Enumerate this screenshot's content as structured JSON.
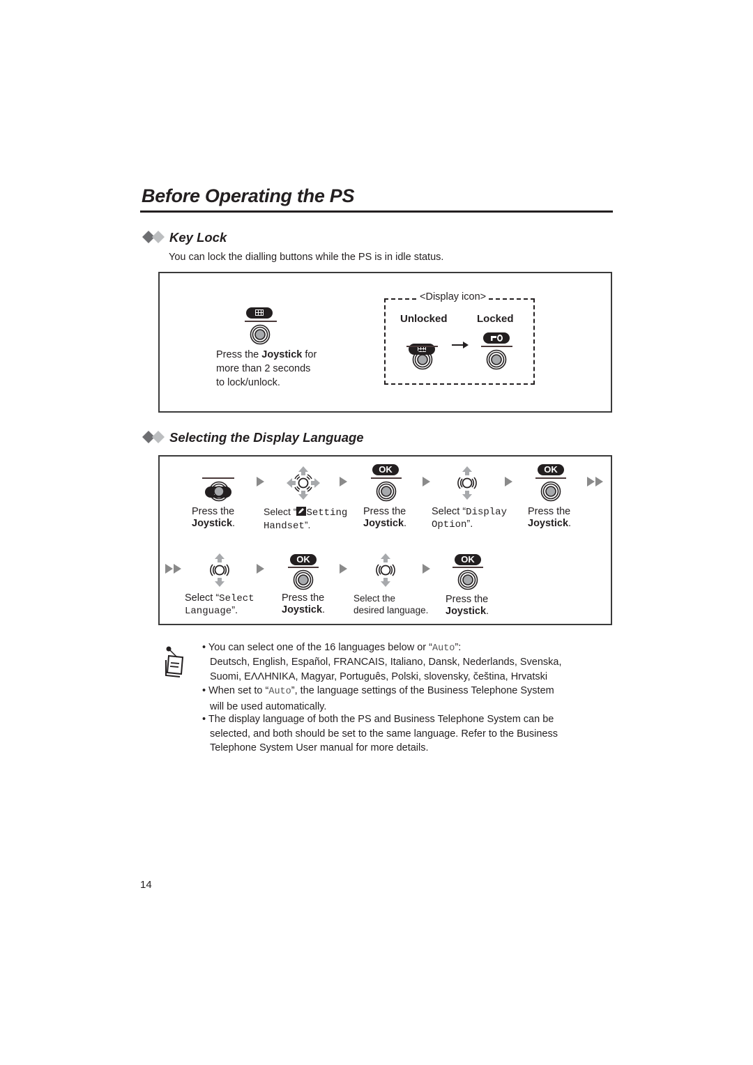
{
  "page": {
    "title": "Before Operating the PS",
    "page_number": "14"
  },
  "key_lock": {
    "heading": "Key Lock",
    "intro": "You can lock the dialling buttons while the PS is in idle status.",
    "instruction_prefix": "Press the ",
    "instruction_bold": "Joystick",
    "instruction_suffix": " for",
    "instruction_line2": "more than 2 seconds",
    "instruction_line3": "to lock/unlock.",
    "display_icon_label": "<Display icon>",
    "unlocked_label": "Unlocked",
    "locked_label": "Locked",
    "icons": {
      "menu": "grid-menu-icon",
      "lock": "key-icon",
      "joystick": "joystick-press-icon",
      "arrow": "arrow-right-icon"
    }
  },
  "display_language": {
    "heading": "Selecting the Display Language",
    "row1": [
      {
        "icon": "menu-joystick",
        "line1": "Press the",
        "line2_bold": "Joystick",
        "line2_suffix": "."
      },
      {
        "icon": "joystick-4way",
        "prefix": "Select “",
        "mono1": "Setting",
        "mono2": "Handset",
        "suffix": "”."
      },
      {
        "icon": "ok-joystick",
        "line1": "Press the",
        "line2_bold": "Joystick",
        "line2_suffix": "."
      },
      {
        "icon": "joystick-updown",
        "prefix": "Select “",
        "mono1": "Display",
        "mono2": "Option",
        "suffix": "”."
      },
      {
        "icon": "ok-joystick",
        "line1": "Press the",
        "line2_bold": "Joystick",
        "line2_suffix": "."
      }
    ],
    "row2": [
      {
        "icon": "joystick-updown",
        "prefix": "Select “",
        "mono1": "Select",
        "mono2": "Language",
        "suffix": "”."
      },
      {
        "icon": "ok-joystick",
        "line1": "Press the",
        "line2_bold": "Joystick",
        "line2_suffix": "."
      },
      {
        "icon": "joystick-updown",
        "line1": "Select the",
        "line2": "desired language."
      },
      {
        "icon": "ok-joystick",
        "line1": "Press the",
        "line2_bold": "Joystick",
        "line2_suffix": "."
      }
    ],
    "ok_label": "OK"
  },
  "notes": {
    "icon": "notepad-icon",
    "bullet1_prefix": "You can select one of the 16 languages below or “",
    "bullet1_mono": "Auto",
    "bullet1_suffix": "”:",
    "languages_line1": "Deutsch, English, Español, FRANCAIS, Italiano, Dansk, Nederlands, Svenska,",
    "languages_line2": "Suomi, ΕΛΛΗΝΙΚΑ, Magyar, Português, Polski, slovensky, čeština, Hrvatski",
    "bullet2_prefix": "When set to “",
    "bullet2_mono": "Auto",
    "bullet2_suffix": "”, the language settings of the Business Telephone System",
    "bullet2_line2": "will be used automatically.",
    "bullet3_line1": "The display language of both the PS and Business Telephone System can be",
    "bullet3_line2": "selected, and both should be set to the same language. Refer to the Business",
    "bullet3_line3": "Telephone System User manual for more details."
  }
}
